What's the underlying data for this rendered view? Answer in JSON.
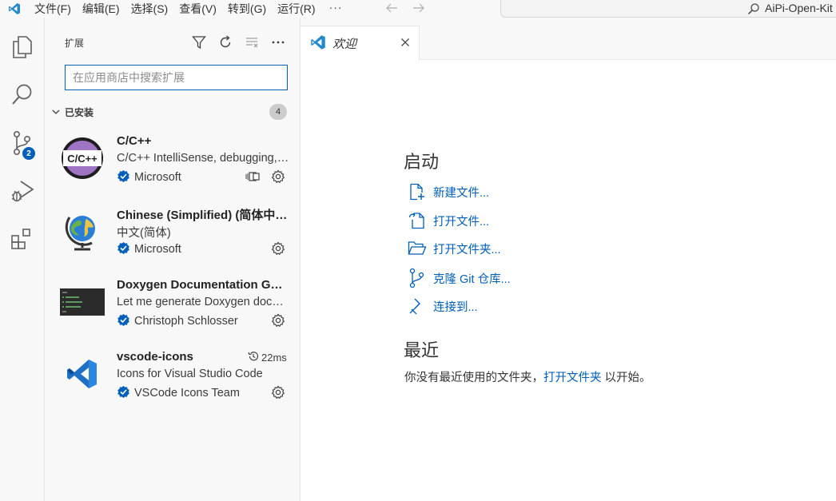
{
  "titlebar": {
    "menu": [
      "文件(F)",
      "编辑(E)",
      "选择(S)",
      "查看(V)",
      "转到(G)",
      "运行(R)"
    ],
    "more": "···",
    "back_icon": "arrow-left-icon",
    "forward_icon": "arrow-right-icon",
    "search_text": "AiPi-Open-Kit"
  },
  "activitybar": {
    "items": [
      {
        "icon": "explorer-icon"
      },
      {
        "icon": "search-icon"
      },
      {
        "icon": "source-control-icon",
        "badge": "2"
      },
      {
        "icon": "run-debug-icon"
      },
      {
        "icon": "extensions-icon"
      }
    ]
  },
  "sidebar": {
    "title": "扩展",
    "actions": [
      "filter-icon",
      "refresh-icon",
      "clear-icon",
      "more-icon"
    ],
    "search_placeholder": "在应用商店中搜索扩展",
    "section": {
      "label": "已安装",
      "count": "4"
    },
    "extensions": [
      {
        "name": "C/C++",
        "description": "C/C++ IntelliSense, debugging, and code browsing.",
        "publisher": "Microsoft",
        "verified": true,
        "icon": "cpp-icon",
        "extra_icon": "remote-sync-icon"
      },
      {
        "name": "Chinese (Simplified) (简体中文) Language Pack for Visual Studio Code",
        "description": "中文(简体)",
        "publisher": "Microsoft",
        "verified": true,
        "icon": "globe-icon"
      },
      {
        "name": "Doxygen Documentation Generator",
        "description": "Let me generate Doxygen documentation from your source code for you.",
        "publisher": "Christoph Schlosser",
        "verified": true,
        "icon": "doxygen-terminal-icon"
      },
      {
        "name": "vscode-icons",
        "description": "Icons for Visual Studio Code",
        "publisher": "VSCode Icons Team",
        "verified": true,
        "icon": "vscode-icons-logo",
        "time": "22ms"
      }
    ]
  },
  "editor": {
    "tab": {
      "label": "欢迎",
      "icon": "vscode-logo-icon"
    },
    "start": {
      "heading": "启动",
      "actions": [
        {
          "label": "新建文件...",
          "icon": "new-file-icon"
        },
        {
          "label": "打开文件...",
          "icon": "open-file-icon"
        },
        {
          "label": "打开文件夹...",
          "icon": "open-folder-icon"
        },
        {
          "label": "克隆 Git 仓库...",
          "icon": "git-clone-icon"
        },
        {
          "label": "连接到...",
          "icon": "remote-connect-icon"
        }
      ]
    },
    "recent": {
      "heading": "最近",
      "text_before": "你没有最近使用的文件夹，",
      "link": "打开文件夹",
      "text_after": "以开始。"
    }
  },
  "colors": {
    "accent": "#005fb8",
    "sidebar_bg": "#f8f8f8",
    "badge_bg": "#005fb8"
  }
}
